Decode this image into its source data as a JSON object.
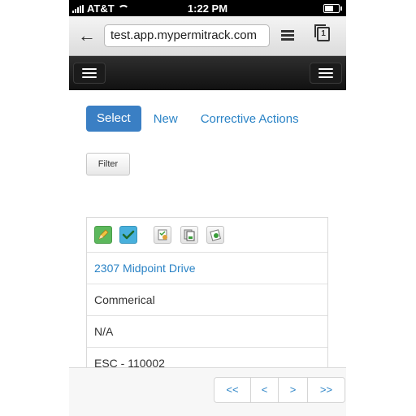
{
  "statusbar": {
    "carrier": "AT&T",
    "time": "1:22 PM"
  },
  "browser": {
    "url": "test.app.mypermitrack.com"
  },
  "tabs": {
    "select": "Select",
    "new": "New",
    "corrective": "Corrective Actions"
  },
  "filter_label": "Filter",
  "record": {
    "address": "2307 Midpoint Drive",
    "type": "Commerical",
    "field3": "N/A",
    "code": "ESC - 110002"
  },
  "pager": {
    "first": "<<",
    "prev": "<",
    "next": ">",
    "last": ">>"
  },
  "colors": {
    "primary": "#3a7fc4",
    "link": "#2a83c6",
    "edit": "#5cb85c",
    "approve": "#48b0dc"
  },
  "icons": [
    "edit-pencil-icon",
    "checkmark-icon",
    "checklist-doc-icon",
    "copy-doc-icon",
    "stamp-doc-icon"
  ]
}
